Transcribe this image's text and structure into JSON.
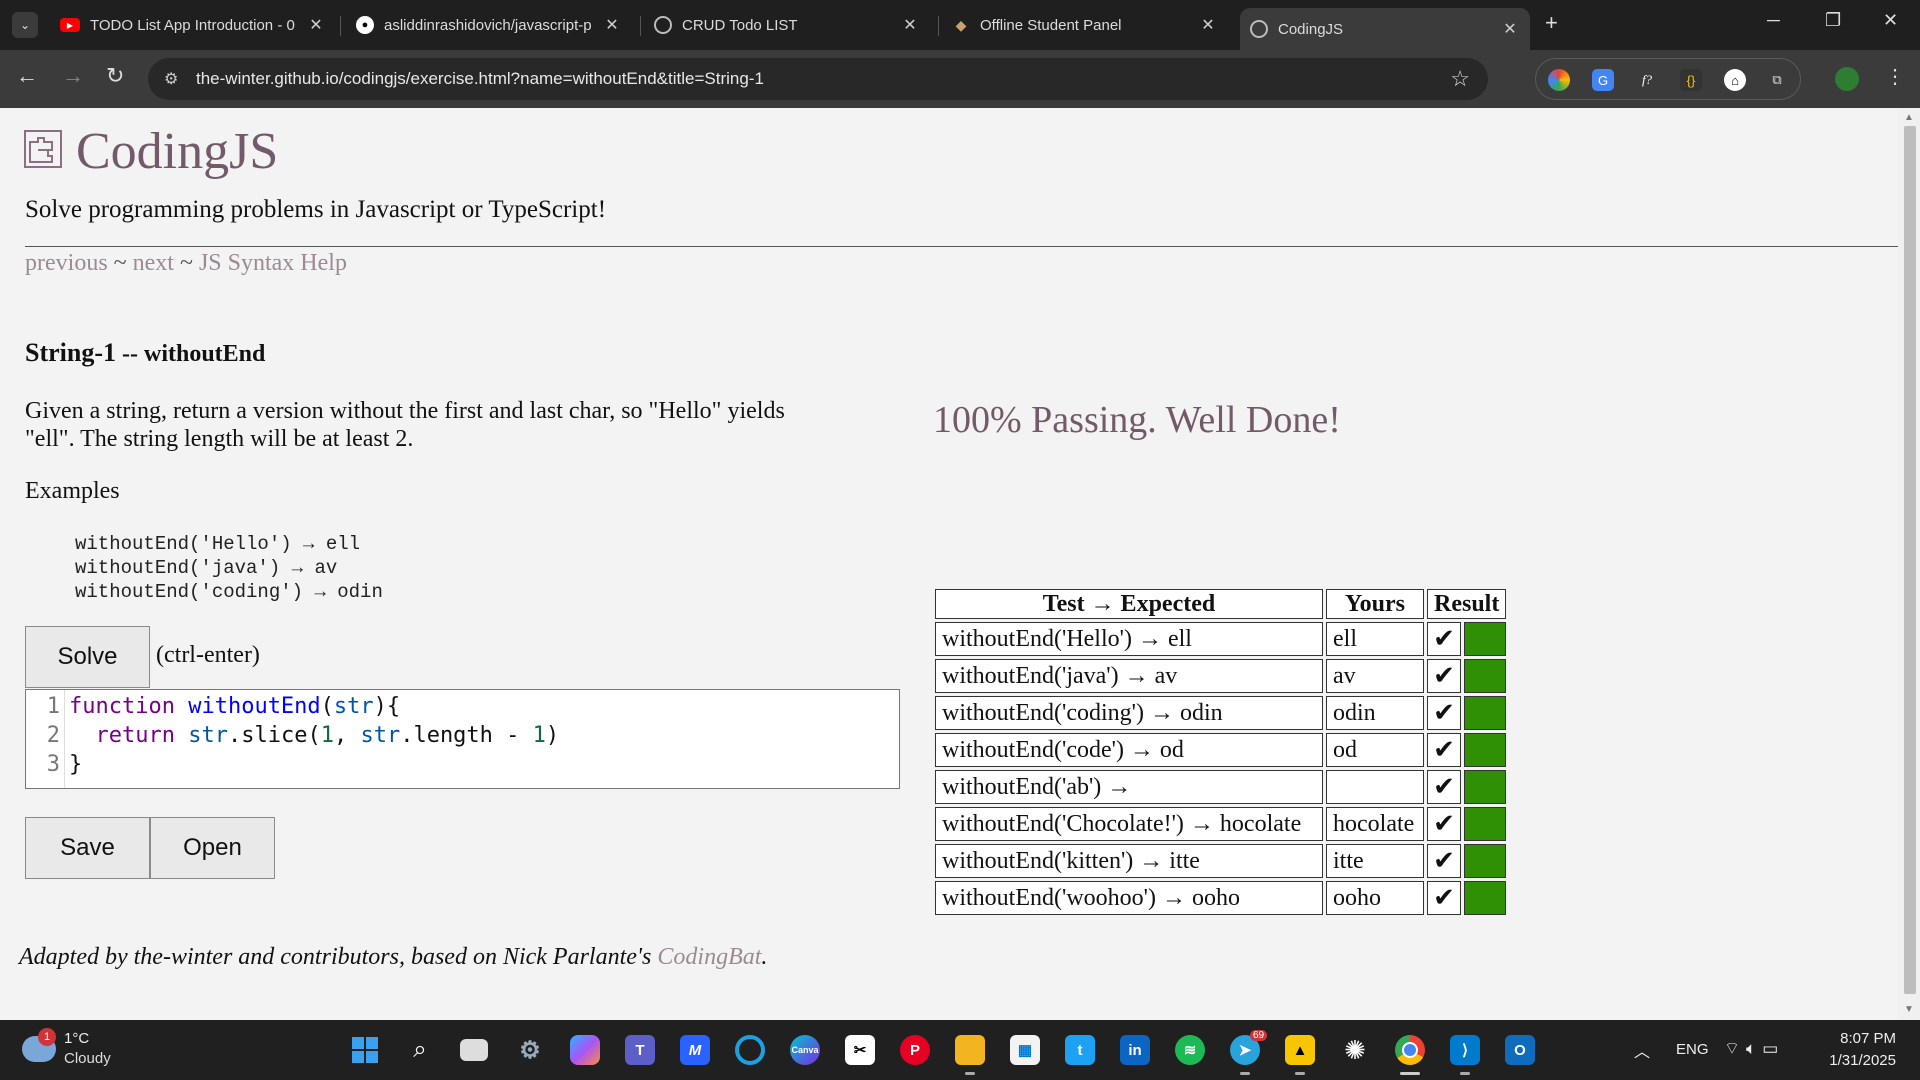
{
  "browser": {
    "tabs": [
      {
        "title": "TODO List App Introduction - 0",
        "favicon": "youtube-icon",
        "active": false
      },
      {
        "title": "asliddinrashidovich/javascript-p",
        "favicon": "github-icon",
        "active": false
      },
      {
        "title": "CRUD Todo LIST",
        "favicon": "globe-icon",
        "active": false
      },
      {
        "title": "Offline Student Panel",
        "favicon": "diamond-icon",
        "active": false
      },
      {
        "title": "CodingJS",
        "favicon": "globe-icon",
        "active": true
      }
    ],
    "url": "the-winter.github.io/codingjs/exercise.html?name=withoutEnd&title=String-1",
    "accent": "#3b3b3b"
  },
  "page": {
    "site_title": "CodingJS",
    "tagline": "Solve programming problems in Javascript or TypeScript!",
    "nav": {
      "previous": "previous",
      "sep1": " ~ ",
      "next": "next",
      "sep2": " ~ ",
      "help": "JS Syntax Help"
    },
    "problem": {
      "category": "String-1",
      "separator": " -- ",
      "name": "withoutEnd",
      "description": "Given a string, return a version without the first and last char, so \"Hello\" yields \"ell\". The string length will be at least 2.",
      "examples_label": "Examples",
      "examples": [
        "withoutEnd('Hello') → ell",
        "withoutEnd('java') → av",
        "withoutEnd('coding') → odin"
      ]
    },
    "buttons": {
      "solve": "Solve",
      "ctrl_hint": "(ctrl-enter)",
      "save": "Save",
      "open": "Open"
    },
    "editor": {
      "line_numbers": [
        "1",
        "2",
        "3"
      ]
    },
    "result_message": "100% Passing. Well Done!",
    "results_table": {
      "headers": [
        "Test → Expected",
        "Yours",
        "Result"
      ],
      "pass_color": "#2f8f05",
      "rows": [
        {
          "test": "withoutEnd('Hello') → ell",
          "yours": "ell",
          "check": "✔"
        },
        {
          "test": "withoutEnd('java') → av",
          "yours": "av",
          "check": "✔"
        },
        {
          "test": "withoutEnd('coding') → odin",
          "yours": "odin",
          "check": "✔"
        },
        {
          "test": "withoutEnd('code') → od",
          "yours": "od",
          "check": "✔"
        },
        {
          "test": "withoutEnd('ab') →",
          "yours": "",
          "check": "✔"
        },
        {
          "test": "withoutEnd('Chocolate!') → hocolate",
          "yours": "hocolate",
          "check": "✔"
        },
        {
          "test": "withoutEnd('kitten') → itte",
          "yours": "itte",
          "check": "✔"
        },
        {
          "test": "withoutEnd('woohoo') → ooho",
          "yours": "ooho",
          "check": "✔"
        }
      ]
    },
    "footer": {
      "text": "Adapted by the-winter and contributors, based on Nick Parlante's ",
      "link": "CodingBat",
      "end": "."
    }
  },
  "taskbar": {
    "weather": {
      "temp": "1°C",
      "desc": "Cloudy",
      "badge": "1"
    },
    "telegram_badge": "69",
    "lang": "ENG",
    "time": "8:07 PM",
    "date": "1/31/2025"
  }
}
